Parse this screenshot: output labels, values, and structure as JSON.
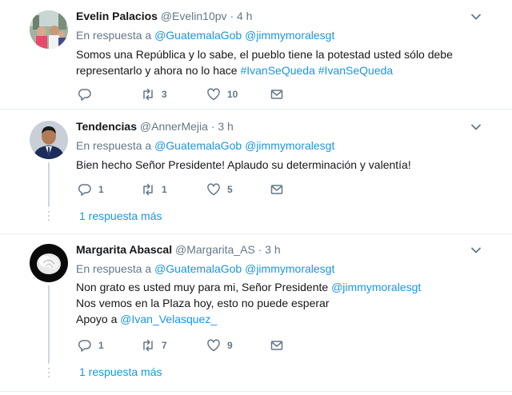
{
  "colors": {
    "link": "#1b95e0",
    "meta": "#657786",
    "text": "#14171a",
    "divider": "#e6ecf0"
  },
  "tweets": [
    {
      "name": "Evelin Palacios",
      "handle": "@Evelin10pv",
      "dot": "·",
      "time": "4 h",
      "reply_prefix": "En respuesta a",
      "reply_users": [
        "@GuatemalaGob",
        "@jimmymoralesgt"
      ],
      "text_line1": "Somos una República y lo sabe, el pueblo tiene la potestad usted sólo debe",
      "text_line2_plain": "representarlo y ahora no lo hace",
      "hashtags": [
        "#IvanSeQueda",
        "#IvanSeQueda"
      ],
      "replies": "",
      "retweets": "3",
      "likes": "10",
      "avatar_icon": "group-photo-avatar"
    },
    {
      "name": "Tendencias",
      "handle": "@AnnerMejia",
      "dot": "·",
      "time": "3 h",
      "reply_prefix": "En respuesta a",
      "reply_users": [
        "@GuatemalaGob",
        "@jimmymoralesgt"
      ],
      "text": "Bien hecho Señor Presidente! Aplaudo su determinación y valentía!",
      "replies": "1",
      "retweets": "1",
      "likes": "5",
      "more_replies": "1 respuesta más",
      "avatar_icon": "man-in-suit-avatar"
    },
    {
      "name": "Margarita Abascal",
      "handle": "@Margarita_AS",
      "dot": "·",
      "time": "3 h",
      "reply_prefix": "En respuesta a",
      "reply_users": [
        "@GuatemalaGob",
        "@jimmymoralesgt"
      ],
      "text_line1_plain": "Non grato es usted muy para mi, Señor Presidente",
      "text_line1_mention": "@jimmymoralesgt",
      "text_line2": "Nos vemos en la Plaza hoy, esto no puede esperar",
      "text_line3_plain": "Apoyo a",
      "text_line3_mention": "@Ivan_Velasquez_",
      "replies": "1",
      "retweets": "7",
      "likes": "9",
      "more_replies": "1 respuesta más",
      "avatar_icon": "white-rose-avatar"
    }
  ]
}
